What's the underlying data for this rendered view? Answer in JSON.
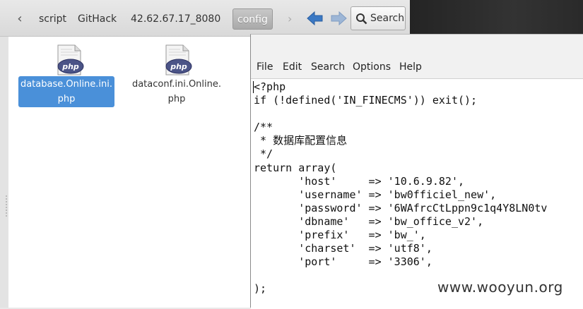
{
  "file_manager": {
    "breadcrumbs": [
      {
        "label": "script"
      },
      {
        "label": "GitHack"
      },
      {
        "label": "42.62.67.17_8080"
      },
      {
        "label": "config",
        "active": true
      }
    ],
    "search_label": "Search",
    "back_icon": "chevron-left-icon",
    "forward_icon": "chevron-right-icon",
    "files": [
      {
        "name_line1": "database.Online.ini.",
        "name_line2": "php",
        "selected": true,
        "icon": "php-file-icon"
      },
      {
        "name_line1": "dataconf.ini.Online.",
        "name_line2": "php",
        "selected": false,
        "icon": "php-file-icon"
      }
    ],
    "colors": {
      "selection": "#4a90d9",
      "nav_arrow": "#3b79c4"
    }
  },
  "editor": {
    "menu": [
      "File",
      "Edit",
      "Search",
      "Options",
      "Help"
    ],
    "code_lines": [
      "<?php",
      "if (!defined('IN_FINECMS')) exit();",
      "",
      "/**",
      " * 数据库配置信息",
      " */",
      "return array(",
      "       'host'     => '10.6.9.82',",
      "       'username' => 'bw0fficiel_new',",
      "       'password' => '6WAfrcCtLppn9c1q4Y8LN0tv",
      "       'dbname'   => 'bw_office_v2',",
      "       'prefix'   => 'bw_',",
      "       'charset'  => 'utf8',",
      "       'port'     => '3306',",
      "",
      ");"
    ]
  },
  "watermark": "www.wooyun.org"
}
